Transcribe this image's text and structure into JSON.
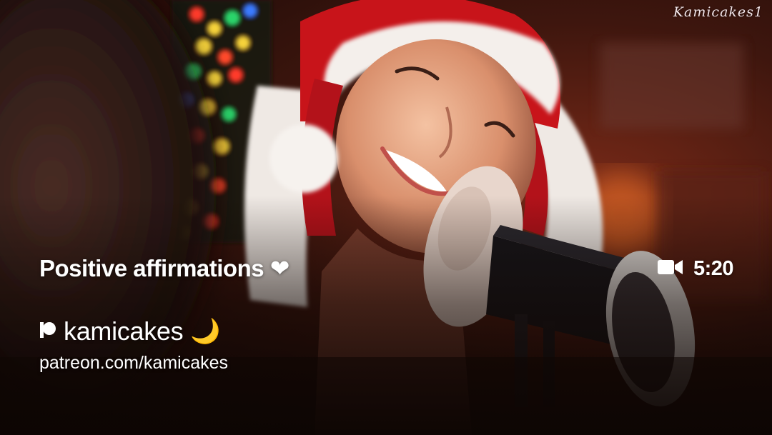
{
  "watermark": "Kamicakes1",
  "video": {
    "title": "Positive affirmations",
    "title_emoji": "❤",
    "duration": "5:20",
    "duration_icon": "video-camera-icon"
  },
  "creator": {
    "platform_icon": "patreon-icon",
    "name": "kamicakes",
    "name_emoji": "🌙",
    "link": "patreon.com/kamicakes"
  },
  "colors": {
    "text": "#ffffff",
    "hat_red": "#c8141a",
    "hat_fur": "#f2ece8",
    "moon": "#f5c542"
  }
}
